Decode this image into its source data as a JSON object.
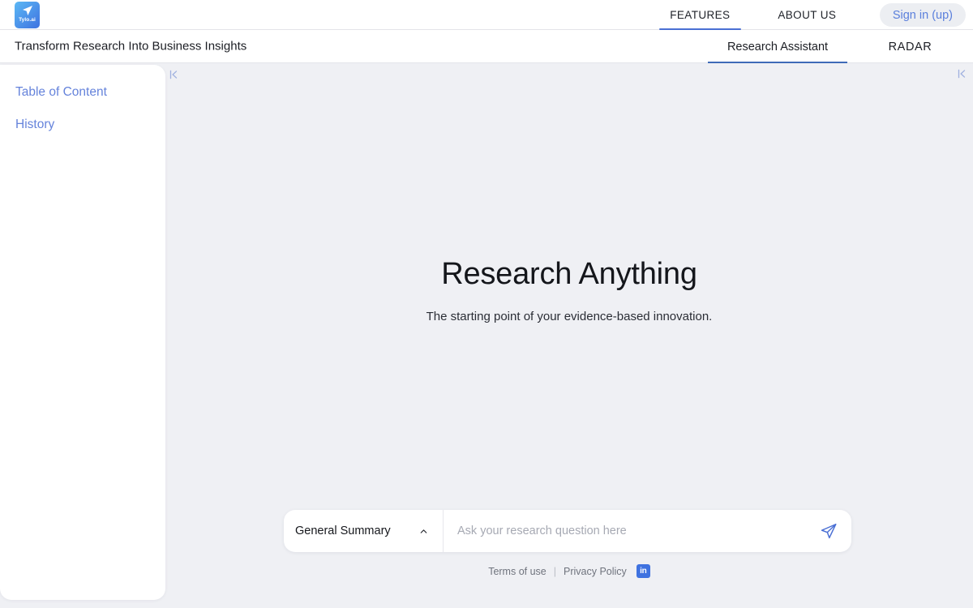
{
  "brand": {
    "name": "Tylo.ai",
    "logo_icon": "paper-plane-icon",
    "accent": "#4a6fd4",
    "logo_gradient_from": "#5bb8f5",
    "logo_gradient_to": "#3f72e0"
  },
  "topnav": {
    "features_label": "FEATURES",
    "about_label": "ABOUT US",
    "signin_label": "Sign in (up)",
    "active": "FEATURES"
  },
  "subnav": {
    "page_title": "Transform Research Into Business Insights",
    "research_assistant_label": "Research Assistant",
    "radar_label": "RADAR",
    "active": "Research Assistant"
  },
  "sidebar": {
    "items": [
      {
        "label": "Table of Content"
      },
      {
        "label": "History"
      }
    ],
    "collapse_icon": "collapse-left-icon"
  },
  "main": {
    "collapse_icon": "collapse-left-icon",
    "hero_title": "Research Anything",
    "hero_subtitle": "The starting point of your evidence-based innovation."
  },
  "query": {
    "mode_value": "General Summary",
    "mode_chevron_icon": "chevron-up-icon",
    "placeholder": "Ask your research question here",
    "input_value": "",
    "send_icon": "send-paper-plane-icon",
    "send_color": "#4a6fd4"
  },
  "footer": {
    "terms_label": "Terms of use",
    "separator": "|",
    "privacy_label": "Privacy Policy",
    "linkedin_icon": "linkedin-icon",
    "linkedin_text": "in"
  }
}
